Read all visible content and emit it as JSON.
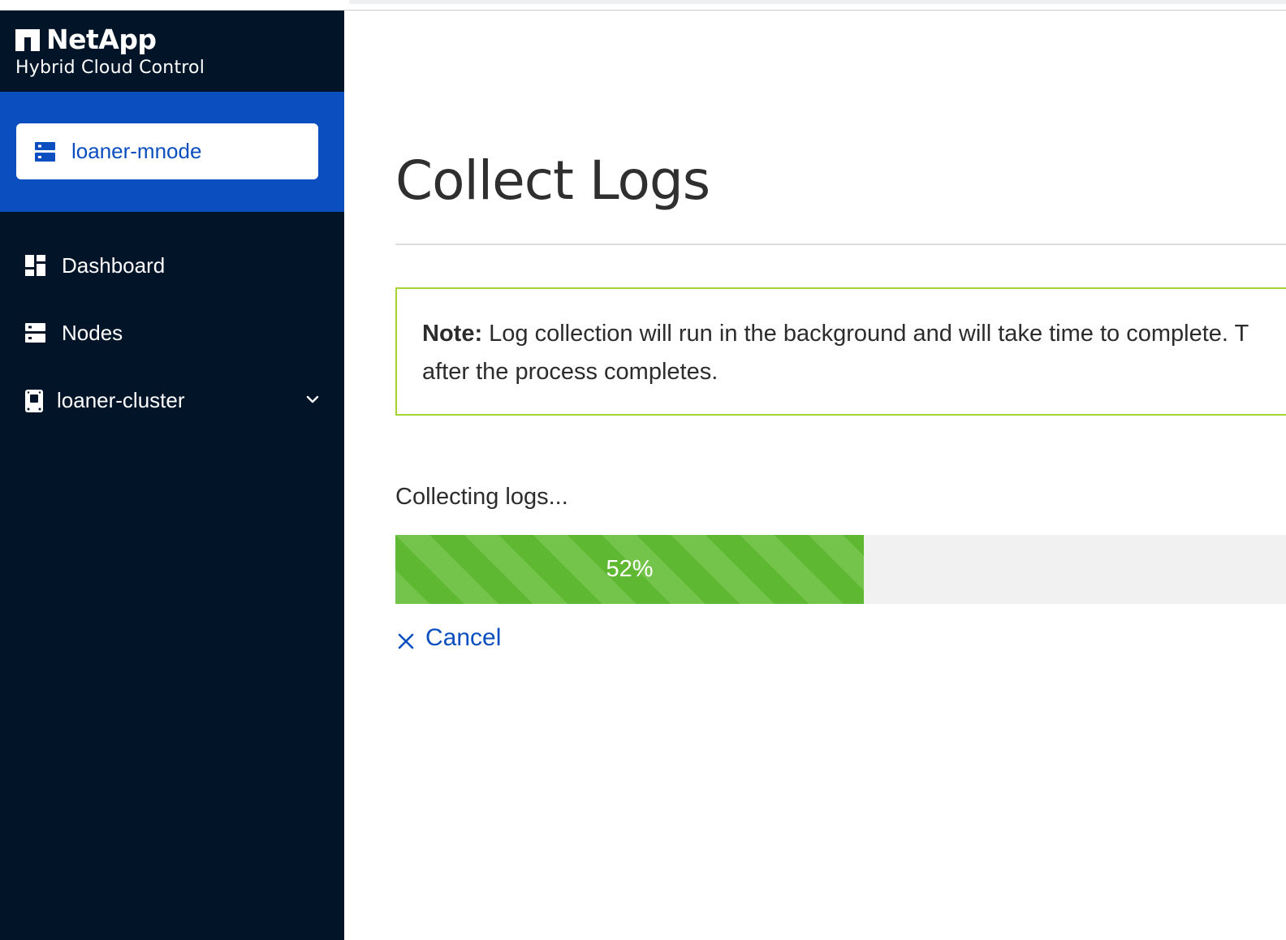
{
  "brand": {
    "name": "NetApp",
    "subtitle": "Hybrid Cloud Control"
  },
  "context": {
    "label": "loaner-mnode",
    "icon": "server-icon"
  },
  "nav": {
    "items": [
      {
        "label": "Dashboard",
        "icon": "dashboard-icon"
      },
      {
        "label": "Nodes",
        "icon": "server-icon"
      },
      {
        "label": "loaner-cluster",
        "icon": "cluster-icon",
        "expandable": true
      }
    ]
  },
  "page": {
    "title": "Collect Logs",
    "note_label": "Note:",
    "note_line1": "Log collection will run in the background and will take time to complete. T",
    "note_line2": "after the process completes.",
    "progress_label": "Collecting logs...",
    "progress_text": "52%",
    "progress_fraction": 0.52,
    "cancel_label": "Cancel"
  },
  "colors": {
    "sidebar_bg": "#011428",
    "accent_blue": "#0a4ebf",
    "progress_green": "#5fb832",
    "note_border": "#a6d430"
  }
}
